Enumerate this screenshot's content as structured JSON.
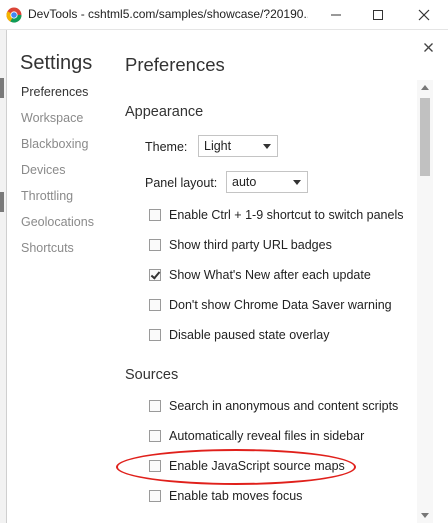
{
  "window": {
    "title": "DevTools - cshtml5.com/samples/showcase/?20190...",
    "icon": "chrome-icon",
    "controls": [
      "minimize-icon",
      "maximize-icon",
      "close-icon"
    ]
  },
  "settings": {
    "title": "Settings",
    "nav": [
      {
        "label": "Preferences",
        "active": true
      },
      {
        "label": "Workspace"
      },
      {
        "label": "Blackboxing"
      },
      {
        "label": "Devices"
      },
      {
        "label": "Throttling"
      },
      {
        "label": "Geolocations"
      },
      {
        "label": "Shortcuts"
      }
    ]
  },
  "preferences": {
    "title": "Preferences",
    "appearance": {
      "section_title": "Appearance",
      "theme_label": "Theme:",
      "theme_value": "Light",
      "panel_layout_label": "Panel layout:",
      "panel_layout_value": "auto",
      "checkboxes": [
        {
          "label": "Enable Ctrl + 1-9 shortcut to switch panels",
          "checked": false
        },
        {
          "label": "Show third party URL badges",
          "checked": false
        },
        {
          "label": "Show What's New after each update",
          "checked": true
        },
        {
          "label": "Don't show Chrome Data Saver warning",
          "checked": false
        },
        {
          "label": "Disable paused state overlay",
          "checked": false
        }
      ]
    },
    "sources": {
      "section_title": "Sources",
      "checkboxes": [
        {
          "label": "Search in anonymous and content scripts",
          "checked": false
        },
        {
          "label": "Automatically reveal files in sidebar",
          "checked": false
        },
        {
          "label": "Enable JavaScript source maps",
          "checked": false,
          "highlighted": true
        },
        {
          "label": "Enable tab moves focus",
          "checked": false
        }
      ]
    }
  },
  "annotation": {
    "color": "#e0201b",
    "shape": "ellipse"
  },
  "colors": {
    "annotation_red": "#e0201b",
    "active_text": "#333333",
    "inactive_text": "#8a8a8a"
  }
}
